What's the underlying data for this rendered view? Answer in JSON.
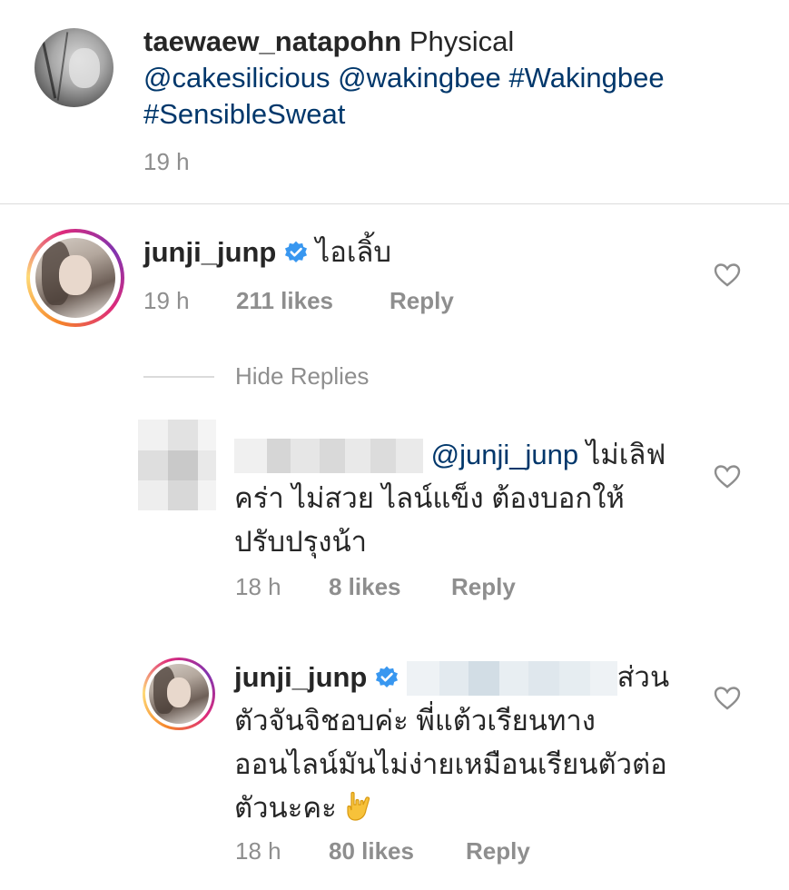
{
  "caption": {
    "username": "taewaew_natapohn",
    "text": " Physical ",
    "mentions": [
      "@cakesilicious",
      "@wakingbee",
      "#Wakingbee",
      "#SensibleSweat"
    ],
    "time": "19 h"
  },
  "comments": [
    {
      "username": "junji_junp",
      "verified": true,
      "text": "ไอเลิ้บ",
      "time": "19 h",
      "likes": "211 likes",
      "reply": "Reply"
    }
  ],
  "replies_toggle": "Hide Replies",
  "replies": [
    {
      "mention": "@junji_junp",
      "text_line1": " ไม่เลิฟ",
      "text_line2": "คร่า ไม่สวย ไลน์แข็ง ต้องบอกให้",
      "text_line3": "ปรับปรุงน้า",
      "time": "18 h",
      "likes": "8 likes",
      "reply": "Reply"
    },
    {
      "username": "junji_junp",
      "verified": true,
      "text_line1": "ส่วน",
      "text_line2": "ตัวจันจิชอบค่ะ พี่แต้วเรียนทาง",
      "text_line3": "ออนไลน์มันไม่ง่ายเหมือนเรียนตัวต่อ",
      "text_line4": "ตัวนะคะ ",
      "emoji": "hand-rock-icon",
      "time": "18 h",
      "likes": "80 likes",
      "reply": "Reply"
    }
  ],
  "colors": {
    "text": "#262626",
    "link": "#00376b",
    "meta": "#8e8e8e",
    "verified": "#3897f0",
    "divider": "#dbdbdb"
  }
}
